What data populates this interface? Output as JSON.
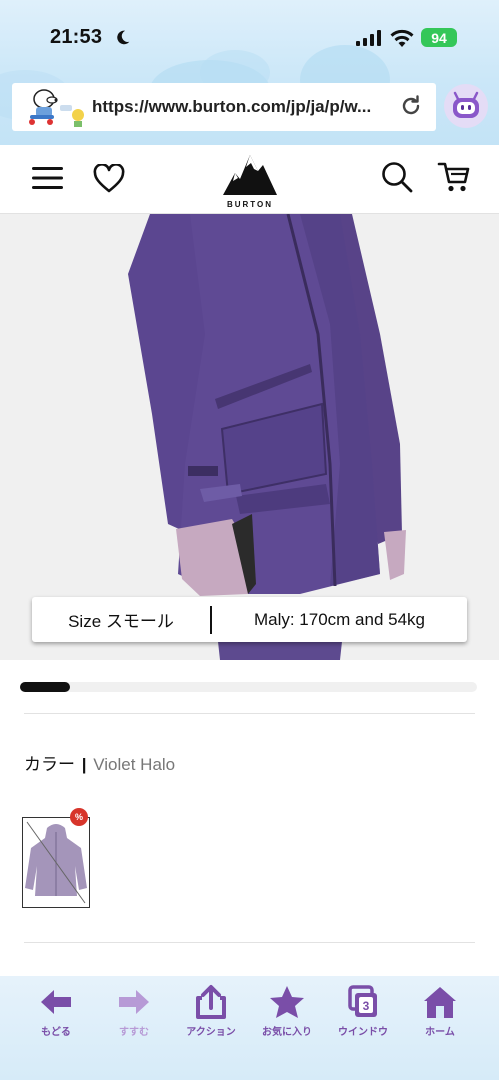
{
  "status_bar": {
    "time": "21:53",
    "battery": "94"
  },
  "browser": {
    "url": "https://www.burton.com/jp/ja/p/w..."
  },
  "header": {
    "logo_text": "BURTON"
  },
  "product_image": {
    "size_label": "Size スモール",
    "model_info": "Maly: 170cm and 54kg"
  },
  "gallery": {
    "progress": 0.11
  },
  "color": {
    "label": "カラー",
    "separator": "|",
    "value": "Violet Halo",
    "badge": "%"
  },
  "toolbar": {
    "items": [
      {
        "label": "もどる",
        "icon": "back-arrow-icon"
      },
      {
        "label": "すすむ",
        "icon": "forward-arrow-icon"
      },
      {
        "label": "アクション",
        "icon": "share-icon"
      },
      {
        "label": "お気に入り",
        "icon": "star-icon"
      },
      {
        "label": "ウインドウ",
        "icon": "windows-icon",
        "count": "3"
      },
      {
        "label": "ホーム",
        "icon": "home-icon"
      }
    ]
  },
  "colors": {
    "accent": "#7a4ea8",
    "jacket": "#5b4690",
    "sale": "#d7352b"
  }
}
